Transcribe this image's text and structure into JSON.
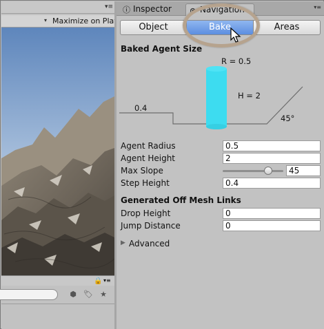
{
  "left_panel": {
    "menu_glyph": "▾≡",
    "toolbar": {
      "dropdown_glyph": "▾",
      "maximize_label": "Maximize on Play"
    },
    "bottom": {
      "lock_icon": "lock-icon",
      "menu_glyph": "▾≡",
      "icons": [
        "filter-by-type-icon",
        "filter-by-label-icon",
        "favorite-star-icon"
      ]
    }
  },
  "tabs": [
    {
      "label": "Inspector",
      "icon": "info-icon"
    },
    {
      "label": "Navigation",
      "icon": "compass-icon"
    }
  ],
  "tab_menu_glyph": "▾≡",
  "segments": [
    "Object",
    "Bake",
    "Areas"
  ],
  "selected_segment": "Bake",
  "baked_agent_size": {
    "title": "Baked Agent Size",
    "diagram": {
      "radius_label": "R = 0.5",
      "height_label": "H = 2",
      "step_label": "0.4",
      "slope_label": "45°"
    },
    "rows": [
      {
        "label": "Agent Radius",
        "value": "0.5"
      },
      {
        "label": "Agent Height",
        "value": "2"
      },
      {
        "label": "Max Slope",
        "value": "45",
        "slider_fraction": 0.75
      },
      {
        "label": "Step Height",
        "value": "0.4"
      }
    ]
  },
  "off_mesh_links": {
    "title": "Generated Off Mesh Links",
    "rows": [
      {
        "label": "Drop Height",
        "value": "0"
      },
      {
        "label": "Jump Distance",
        "value": "0"
      }
    ]
  },
  "advanced": {
    "label": "Advanced",
    "expanded": false
  },
  "colors": {
    "cylinder": "#3ddcf0",
    "selected_segment": "#5c8ee0",
    "highlight_ring": "#b6a38e",
    "panel_bg": "#c2c2c2"
  }
}
